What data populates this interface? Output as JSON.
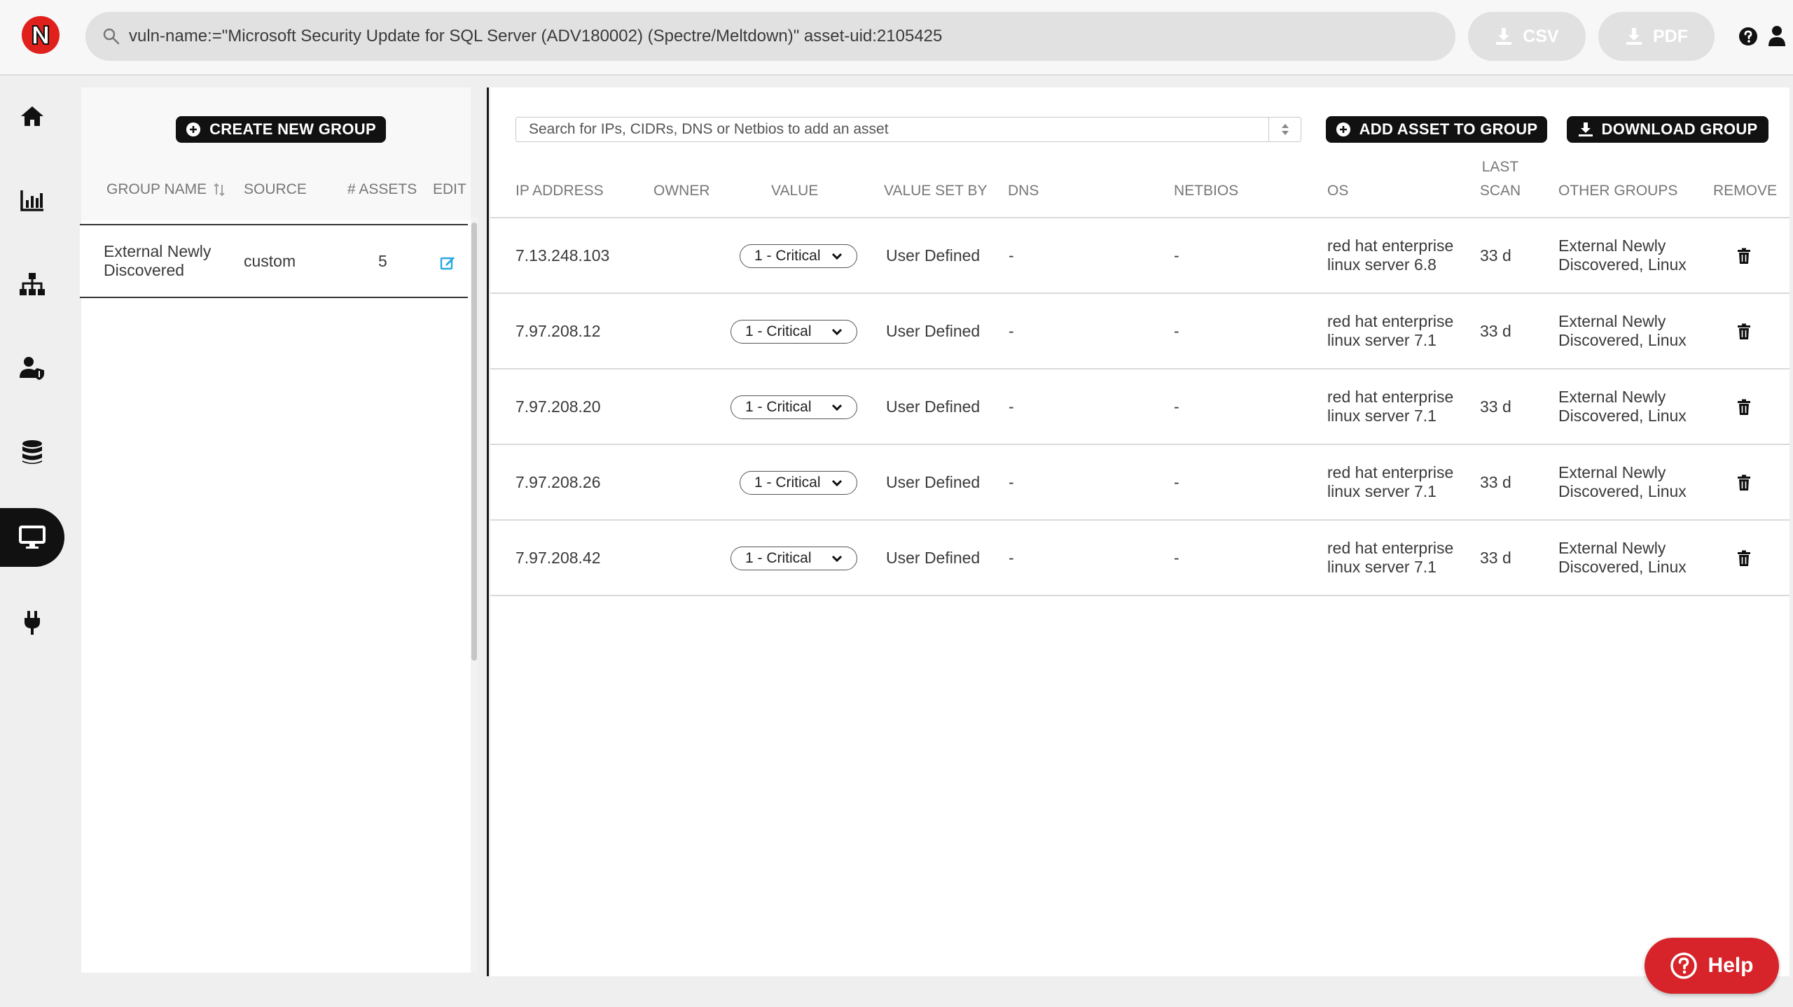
{
  "search": {
    "query": "vuln-name:=\"Microsoft Security Update for SQL Server (ADV180002) (Spectre/Meltdown)\" asset-uid:2105425"
  },
  "export": {
    "csv_label": "CSV",
    "pdf_label": "PDF"
  },
  "nav": [
    "home-icon",
    "chart-icon",
    "sitemap-icon",
    "user-shield-icon",
    "database-icon",
    "desktop-icon",
    "plug-icon"
  ],
  "groups": {
    "create_label": "CREATE NEW GROUP",
    "columns": {
      "name": "GROUP NAME",
      "source": "SOURCE",
      "assets": "# ASSETS",
      "edit": "EDIT"
    },
    "rows": [
      {
        "name_line1": "External Newly",
        "name_line2": "Discovered",
        "source": "custom",
        "assets": "5"
      }
    ]
  },
  "assets": {
    "search_placeholder": "Search for IPs, CIDRs, DNS or Netbios to add an asset",
    "add_label": "ADD ASSET TO GROUP",
    "download_label": "DOWNLOAD GROUP",
    "columns": {
      "ip": "IP ADDRESS",
      "owner": "OWNER",
      "value": "VALUE",
      "value_set_by": "VALUE SET BY",
      "dns": "DNS",
      "netbios": "NETBIOS",
      "os": "OS",
      "last_scan_1": "LAST",
      "last_scan_2": "SCAN",
      "other_groups": "OTHER GROUPS",
      "remove": "REMOVE"
    },
    "rows": [
      {
        "ip": "7.13.248.103",
        "value": "1 - Critical",
        "value_set_by": "User Defined",
        "dns": "-",
        "netbios": "-",
        "os_1": "red hat enterprise",
        "os_2": "linux server 6.8",
        "last_scan": "33 d",
        "groups_1": "External Newly",
        "groups_2": "Discovered, Linux"
      },
      {
        "ip": "7.97.208.12",
        "value": "1 - Critical",
        "value_set_by": "User Defined",
        "dns": "-",
        "netbios": "-",
        "os_1": "red hat enterprise",
        "os_2": "linux server 7.1",
        "last_scan": "33 d",
        "groups_1": "External Newly",
        "groups_2": "Discovered, Linux"
      },
      {
        "ip": "7.97.208.20",
        "value": "1 - Critical",
        "value_set_by": "User Defined",
        "dns": "-",
        "netbios": "-",
        "os_1": "red hat enterprise",
        "os_2": "linux server 7.1",
        "last_scan": "33 d",
        "groups_1": "External Newly",
        "groups_2": "Discovered, Linux"
      },
      {
        "ip": "7.97.208.26",
        "value": "1 - Critical",
        "value_set_by": "User Defined",
        "dns": "-",
        "netbios": "-",
        "os_1": "red hat enterprise",
        "os_2": "linux server 7.1",
        "last_scan": "33 d",
        "groups_1": "External Newly",
        "groups_2": "Discovered, Linux"
      },
      {
        "ip": "7.97.208.42",
        "value": "1 - Critical",
        "value_set_by": "User Defined",
        "dns": "-",
        "netbios": "-",
        "os_1": "red hat enterprise",
        "os_2": "linux server 7.1",
        "last_scan": "33 d",
        "groups_1": "External Newly",
        "groups_2": "Discovered, Linux"
      }
    ]
  },
  "help": {
    "label": "Help"
  },
  "colors": {
    "brand_red": "#e0201b",
    "help_red": "#d6242a",
    "dark": "#111111",
    "edit_blue": "#29a8e0"
  }
}
